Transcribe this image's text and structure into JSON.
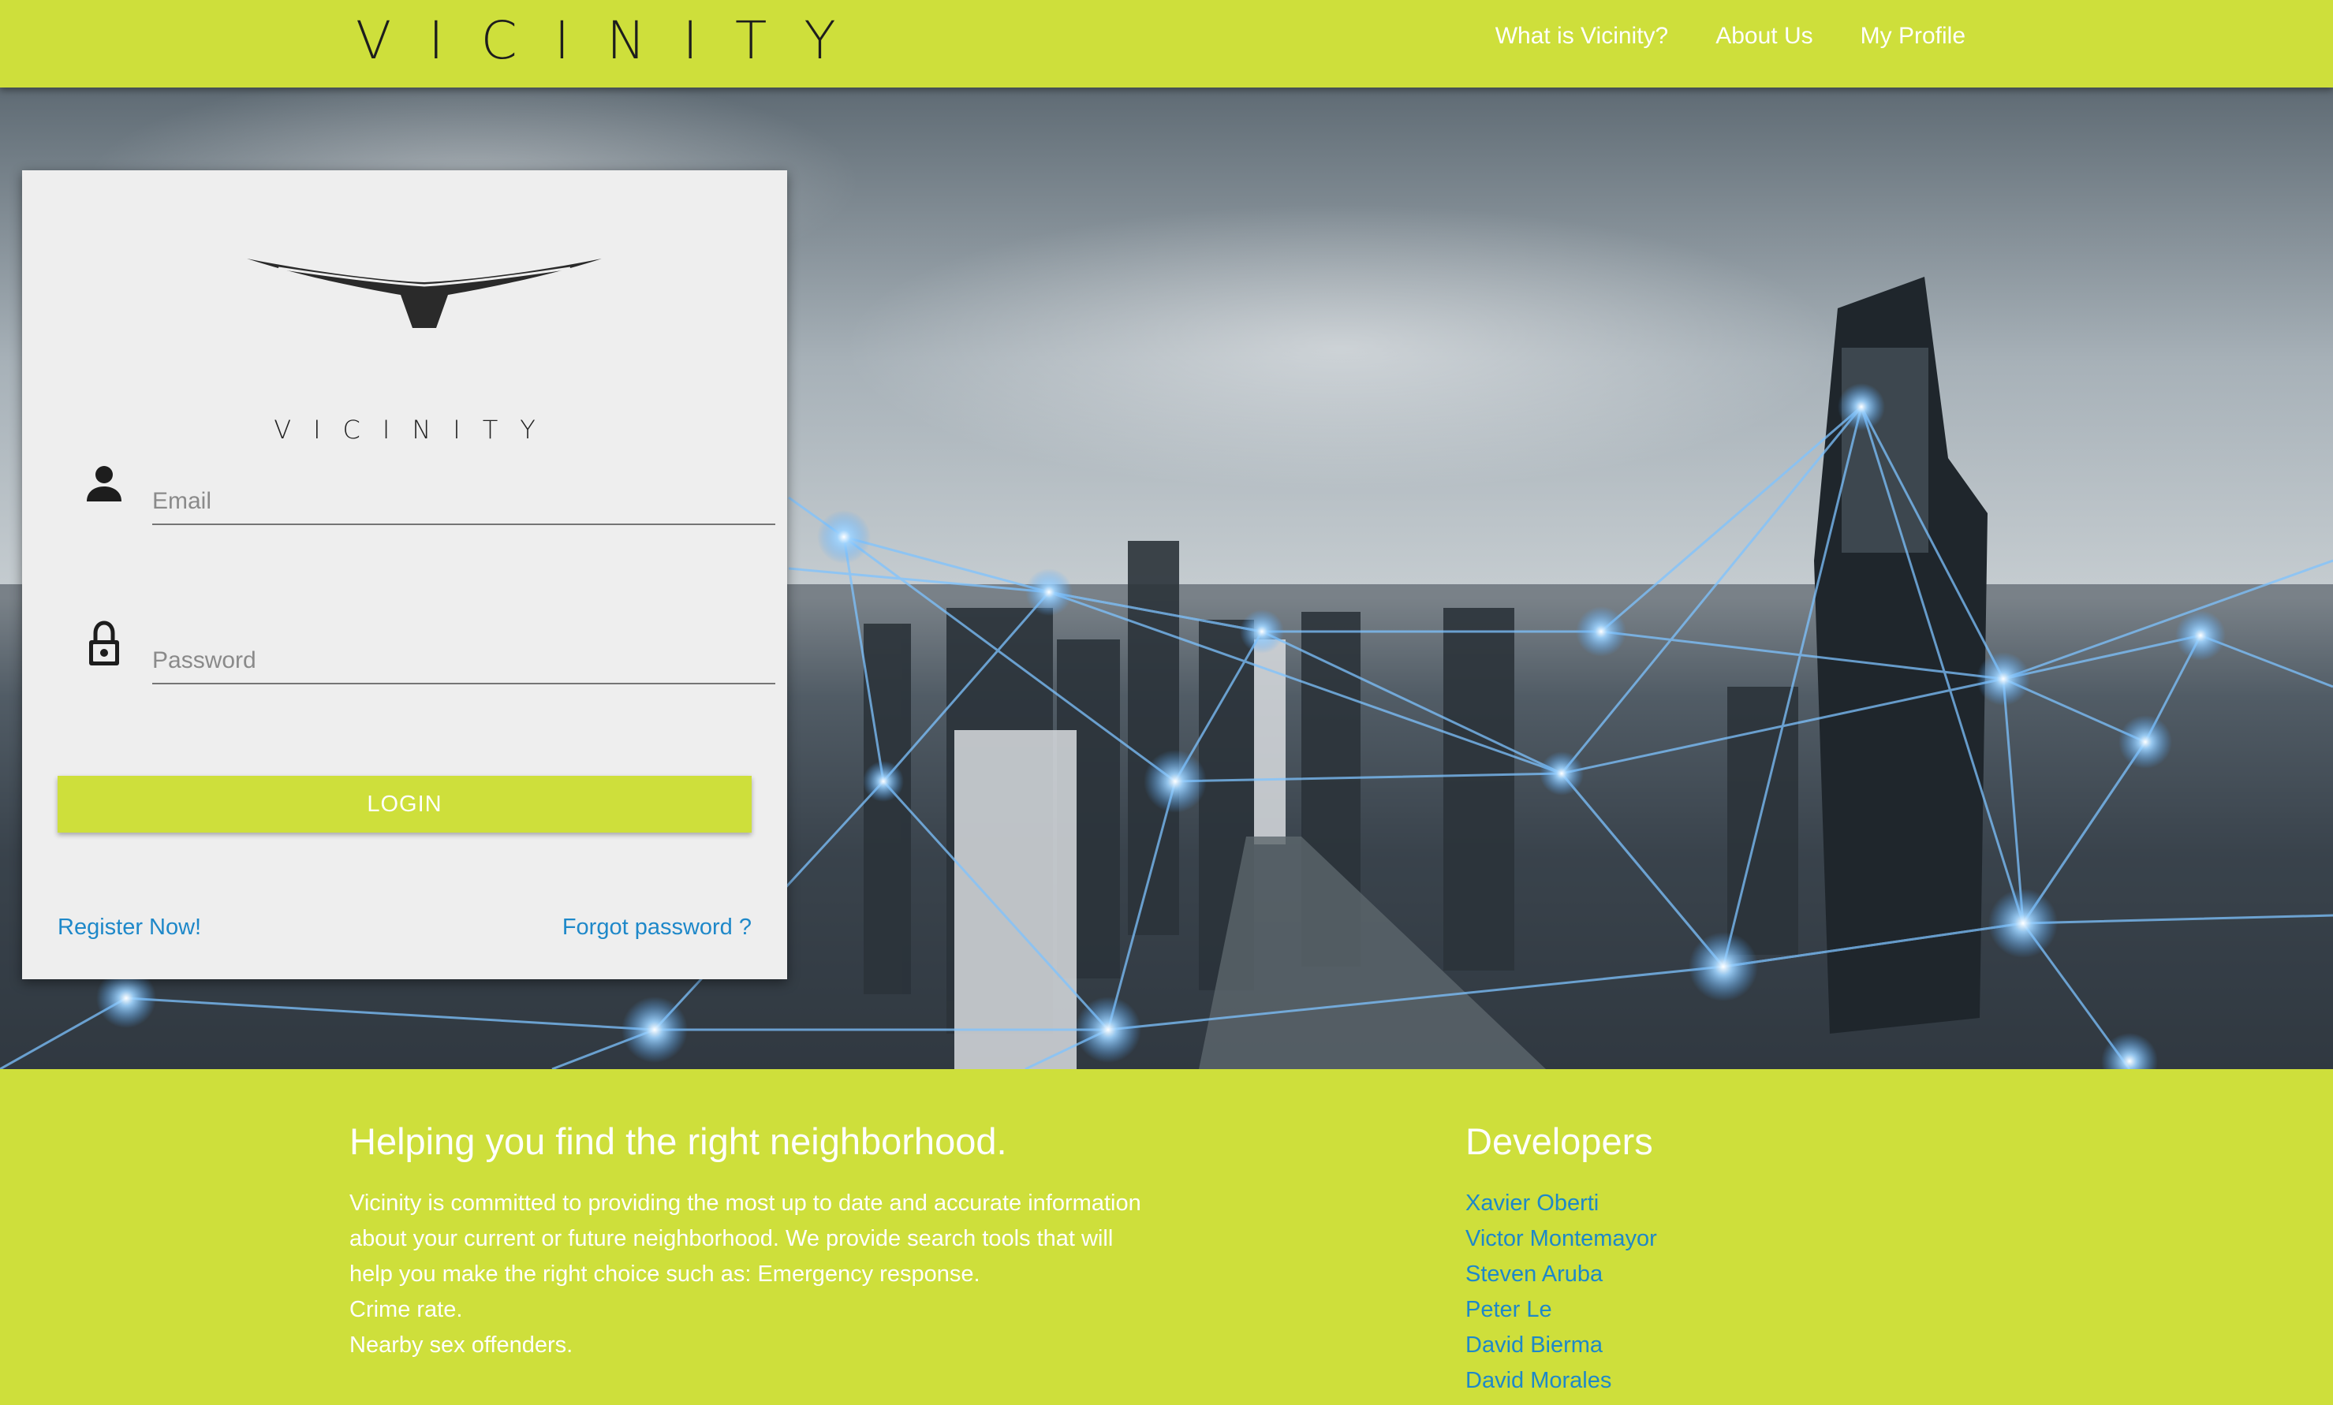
{
  "header": {
    "brand": "VICINITY",
    "nav": [
      "What is Vicinity?",
      "About Us",
      "My Profile"
    ]
  },
  "login": {
    "logo_text": "VICINITY",
    "email_placeholder": "Email",
    "password_placeholder": "Password",
    "login_label": "LOGIN",
    "register_link": "Register Now!",
    "forgot_link": "Forgot password ?"
  },
  "footer": {
    "about_heading": "Helping you find the right neighborhood.",
    "about_text": "Vicinity is committed to providing the most up to date and accurate information about your current or future neighborhood. We provide search tools that will help you make the right choice such as: Emergency response.",
    "about_items": [
      "Crime rate.",
      "Nearby sex offenders."
    ],
    "developers_heading": "Developers",
    "developers": [
      "Xavier Oberti",
      "Victor Montemayor",
      "Steven Aruba",
      "Peter Le",
      "David Bierma",
      "David Morales"
    ]
  },
  "colors": {
    "brand_lime": "#cedf3b",
    "link_blue": "#1e88c9",
    "card_bg": "#eeeeee"
  },
  "icons": [
    "person-icon",
    "lock-icon"
  ]
}
